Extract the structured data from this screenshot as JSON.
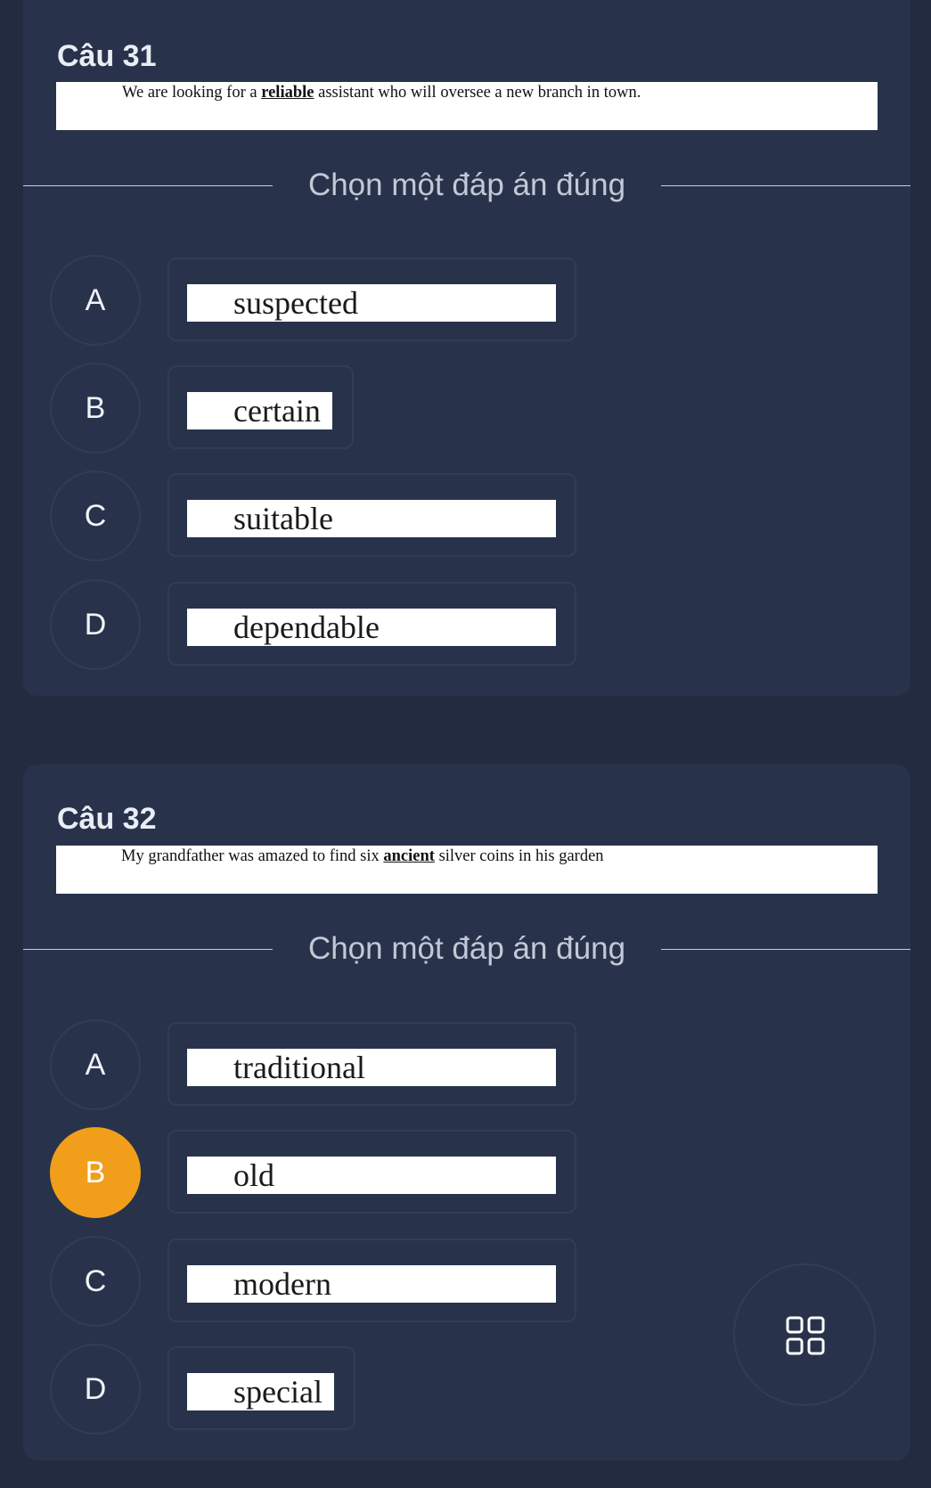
{
  "questions": [
    {
      "title": "Câu 31",
      "text_before": "We are looking for a ",
      "keyword": "reliable",
      "text_after": " assistant who will oversee a new branch in town.",
      "prompt": "Chọn một đáp án đúng",
      "options": [
        {
          "letter": "A",
          "text": "suspected",
          "selected": false
        },
        {
          "letter": "B",
          "text": "certain",
          "selected": false
        },
        {
          "letter": "C",
          "text": "suitable",
          "selected": false
        },
        {
          "letter": "D",
          "text": "dependable",
          "selected": false
        }
      ]
    },
    {
      "title": "Câu 32",
      "text_before": "My grandfather was amazed to find six ",
      "keyword": "ancient",
      "text_after": " silver coins in his garden",
      "prompt": "Chọn một đáp án đúng",
      "options": [
        {
          "letter": "A",
          "text": "traditional",
          "selected": false
        },
        {
          "letter": "B",
          "text": "old",
          "selected": true
        },
        {
          "letter": "C",
          "text": "modern",
          "selected": false
        },
        {
          "letter": "D",
          "text": "special",
          "selected": false
        }
      ]
    }
  ],
  "colors": {
    "page_background": "#222b40",
    "card_background": "#28334b",
    "selected_accent": "#f19f1a"
  },
  "fab": {
    "icon": "grid-icon"
  }
}
